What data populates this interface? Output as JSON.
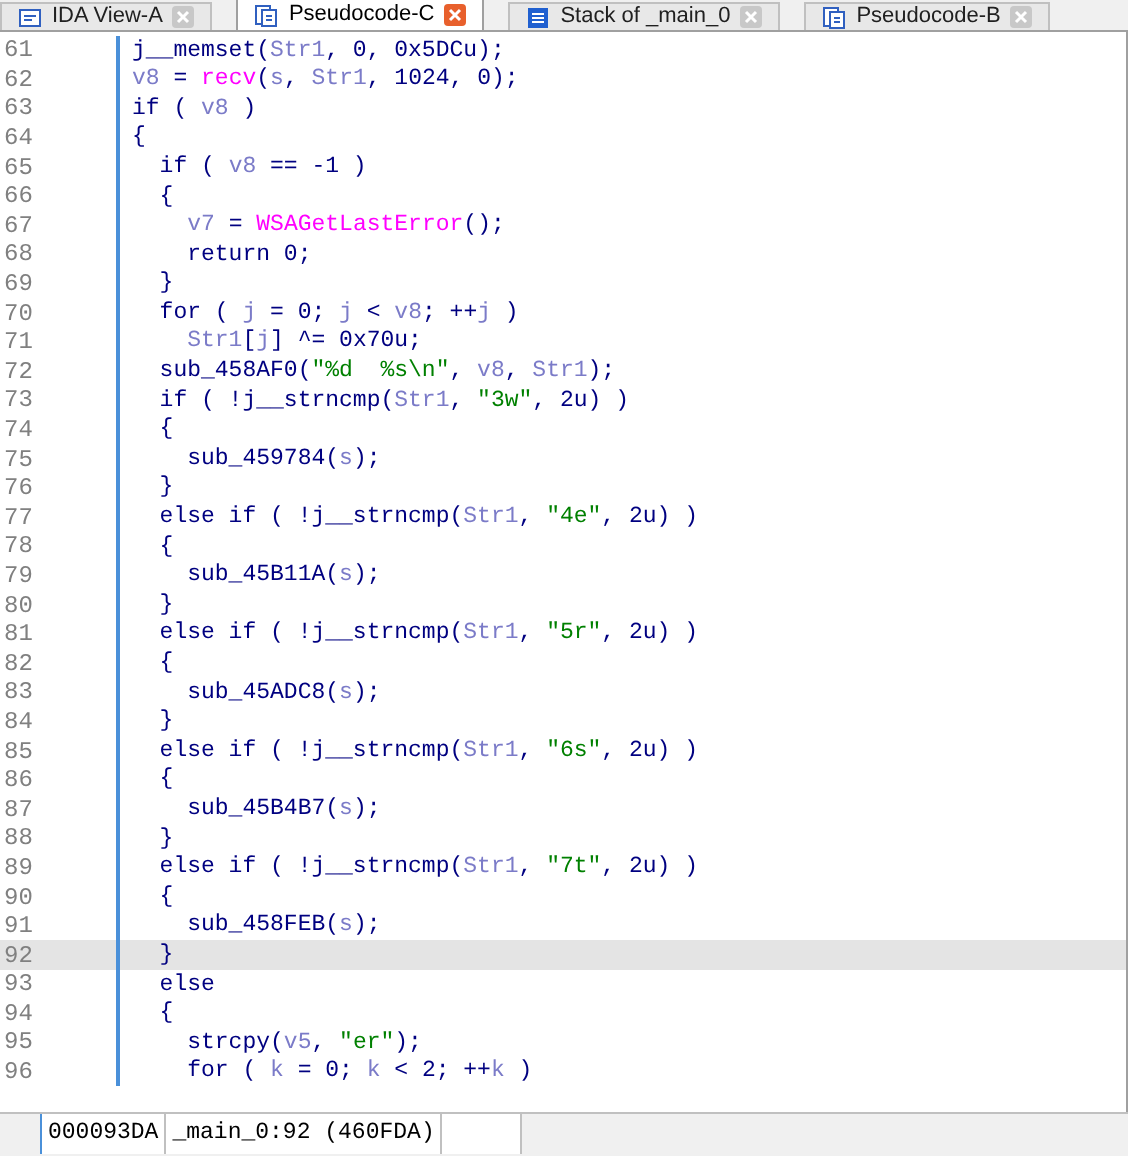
{
  "tabs": [
    {
      "label": "IDA View-A",
      "kind": "disassembly",
      "selected": false
    },
    {
      "label": "Pseudocode-C",
      "kind": "pseudocode",
      "selected": true
    },
    {
      "label": "Stack of _main_0",
      "kind": "stack",
      "selected": false
    },
    {
      "label": "Pseudocode-B",
      "kind": "pseudocode",
      "selected": false
    }
  ],
  "lines": [
    {
      "number": "61",
      "selected": false,
      "parts": [
        {
          "kind": "code",
          "text": "j__memset("
        },
        {
          "kind": "variable",
          "text": "Str1"
        },
        {
          "kind": "code",
          "text": ", 0, 0x5DCu);"
        }
      ]
    },
    {
      "number": "62",
      "selected": false,
      "parts": [
        {
          "kind": "variable",
          "text": "v8"
        },
        {
          "kind": "code",
          "text": " = "
        },
        {
          "kind": "function",
          "text": "recv"
        },
        {
          "kind": "code",
          "text": "("
        },
        {
          "kind": "variable",
          "text": "s"
        },
        {
          "kind": "code",
          "text": ", "
        },
        {
          "kind": "variable",
          "text": "Str1"
        },
        {
          "kind": "code",
          "text": ", 1024, 0);"
        }
      ]
    },
    {
      "number": "63",
      "selected": false,
      "parts": [
        {
          "kind": "code",
          "text": "if ( "
        },
        {
          "kind": "variable",
          "text": "v8"
        },
        {
          "kind": "code",
          "text": " )"
        }
      ]
    },
    {
      "number": "64",
      "selected": false,
      "parts": [
        {
          "kind": "code",
          "text": "{"
        }
      ]
    },
    {
      "number": "65",
      "selected": false,
      "parts": [
        {
          "kind": "code",
          "text": "  if ( "
        },
        {
          "kind": "variable",
          "text": "v8"
        },
        {
          "kind": "code",
          "text": " == -1 )"
        }
      ]
    },
    {
      "number": "66",
      "selected": false,
      "parts": [
        {
          "kind": "code",
          "text": "  {"
        }
      ]
    },
    {
      "number": "67",
      "selected": false,
      "parts": [
        {
          "kind": "variable",
          "text": "    v7"
        },
        {
          "kind": "code",
          "text": " = "
        },
        {
          "kind": "function",
          "text": "WSAGetLastError"
        },
        {
          "kind": "code",
          "text": "();"
        }
      ]
    },
    {
      "number": "68",
      "selected": false,
      "parts": [
        {
          "kind": "code",
          "text": "    return 0;"
        }
      ]
    },
    {
      "number": "69",
      "selected": false,
      "parts": [
        {
          "kind": "code",
          "text": "  }"
        }
      ]
    },
    {
      "number": "70",
      "selected": false,
      "parts": [
        {
          "kind": "code",
          "text": "  for ( "
        },
        {
          "kind": "variable",
          "text": "j"
        },
        {
          "kind": "code",
          "text": " = 0; "
        },
        {
          "kind": "variable",
          "text": "j"
        },
        {
          "kind": "code",
          "text": " < "
        },
        {
          "kind": "variable",
          "text": "v8"
        },
        {
          "kind": "code",
          "text": "; ++"
        },
        {
          "kind": "variable",
          "text": "j"
        },
        {
          "kind": "code",
          "text": " )"
        }
      ]
    },
    {
      "number": "71",
      "selected": false,
      "parts": [
        {
          "kind": "variable",
          "text": "    Str1"
        },
        {
          "kind": "code",
          "text": "["
        },
        {
          "kind": "variable",
          "text": "j"
        },
        {
          "kind": "code",
          "text": "] ^= 0x70u;"
        }
      ]
    },
    {
      "number": "72",
      "selected": false,
      "parts": [
        {
          "kind": "code",
          "text": "  sub_458AF0("
        },
        {
          "kind": "string",
          "text": "\"%d  %s\\n\""
        },
        {
          "kind": "code",
          "text": ", "
        },
        {
          "kind": "variable",
          "text": "v8"
        },
        {
          "kind": "code",
          "text": ", "
        },
        {
          "kind": "variable",
          "text": "Str1"
        },
        {
          "kind": "code",
          "text": ");"
        }
      ]
    },
    {
      "number": "73",
      "selected": false,
      "parts": [
        {
          "kind": "code",
          "text": "  if ( !j__strncmp("
        },
        {
          "kind": "variable",
          "text": "Str1"
        },
        {
          "kind": "code",
          "text": ", "
        },
        {
          "kind": "string",
          "text": "\"3w\""
        },
        {
          "kind": "code",
          "text": ", 2u) )"
        }
      ]
    },
    {
      "number": "74",
      "selected": false,
      "parts": [
        {
          "kind": "code",
          "text": "  {"
        }
      ]
    },
    {
      "number": "75",
      "selected": false,
      "parts": [
        {
          "kind": "code",
          "text": "    sub_459784("
        },
        {
          "kind": "variable",
          "text": "s"
        },
        {
          "kind": "code",
          "text": ");"
        }
      ]
    },
    {
      "number": "76",
      "selected": false,
      "parts": [
        {
          "kind": "code",
          "text": "  }"
        }
      ]
    },
    {
      "number": "77",
      "selected": false,
      "parts": [
        {
          "kind": "code",
          "text": "  else if ( !j__strncmp("
        },
        {
          "kind": "variable",
          "text": "Str1"
        },
        {
          "kind": "code",
          "text": ", "
        },
        {
          "kind": "string",
          "text": "\"4e\""
        },
        {
          "kind": "code",
          "text": ", 2u) )"
        }
      ]
    },
    {
      "number": "78",
      "selected": false,
      "parts": [
        {
          "kind": "code",
          "text": "  {"
        }
      ]
    },
    {
      "number": "79",
      "selected": false,
      "parts": [
        {
          "kind": "code",
          "text": "    sub_45B11A("
        },
        {
          "kind": "variable",
          "text": "s"
        },
        {
          "kind": "code",
          "text": ");"
        }
      ]
    },
    {
      "number": "80",
      "selected": false,
      "parts": [
        {
          "kind": "code",
          "text": "  }"
        }
      ]
    },
    {
      "number": "81",
      "selected": false,
      "parts": [
        {
          "kind": "code",
          "text": "  else if ( !j__strncmp("
        },
        {
          "kind": "variable",
          "text": "Str1"
        },
        {
          "kind": "code",
          "text": ", "
        },
        {
          "kind": "string",
          "text": "\"5r\""
        },
        {
          "kind": "code",
          "text": ", 2u) )"
        }
      ]
    },
    {
      "number": "82",
      "selected": false,
      "parts": [
        {
          "kind": "code",
          "text": "  {"
        }
      ]
    },
    {
      "number": "83",
      "selected": false,
      "parts": [
        {
          "kind": "code",
          "text": "    sub_45ADC8("
        },
        {
          "kind": "variable",
          "text": "s"
        },
        {
          "kind": "code",
          "text": ");"
        }
      ]
    },
    {
      "number": "84",
      "selected": false,
      "parts": [
        {
          "kind": "code",
          "text": "  }"
        }
      ]
    },
    {
      "number": "85",
      "selected": false,
      "parts": [
        {
          "kind": "code",
          "text": "  else if ( !j__strncmp("
        },
        {
          "kind": "variable",
          "text": "Str1"
        },
        {
          "kind": "code",
          "text": ", "
        },
        {
          "kind": "string",
          "text": "\"6s\""
        },
        {
          "kind": "code",
          "text": ", 2u) )"
        }
      ]
    },
    {
      "number": "86",
      "selected": false,
      "parts": [
        {
          "kind": "code",
          "text": "  {"
        }
      ]
    },
    {
      "number": "87",
      "selected": false,
      "parts": [
        {
          "kind": "code",
          "text": "    sub_45B4B7("
        },
        {
          "kind": "variable",
          "text": "s"
        },
        {
          "kind": "code",
          "text": ");"
        }
      ]
    },
    {
      "number": "88",
      "selected": false,
      "parts": [
        {
          "kind": "code",
          "text": "  }"
        }
      ]
    },
    {
      "number": "89",
      "selected": false,
      "parts": [
        {
          "kind": "code",
          "text": "  else if ( !j__strncmp("
        },
        {
          "kind": "variable",
          "text": "Str1"
        },
        {
          "kind": "code",
          "text": ", "
        },
        {
          "kind": "string",
          "text": "\"7t\""
        },
        {
          "kind": "code",
          "text": ", 2u) )"
        }
      ]
    },
    {
      "number": "90",
      "selected": false,
      "parts": [
        {
          "kind": "code",
          "text": "  {"
        }
      ]
    },
    {
      "number": "91",
      "selected": false,
      "parts": [
        {
          "kind": "code",
          "text": "    sub_458FEB("
        },
        {
          "kind": "variable",
          "text": "s"
        },
        {
          "kind": "code",
          "text": ");"
        }
      ]
    },
    {
      "number": "92",
      "selected": true,
      "parts": [
        {
          "kind": "code",
          "text": "  }"
        }
      ]
    },
    {
      "number": "93",
      "selected": false,
      "parts": [
        {
          "kind": "code",
          "text": "  else"
        }
      ]
    },
    {
      "number": "94",
      "selected": false,
      "parts": [
        {
          "kind": "code",
          "text": "  {"
        }
      ]
    },
    {
      "number": "95",
      "selected": false,
      "parts": [
        {
          "kind": "code",
          "text": "    strcpy("
        },
        {
          "kind": "variable",
          "text": "v5"
        },
        {
          "kind": "code",
          "text": ", "
        },
        {
          "kind": "string",
          "text": "\"er\""
        },
        {
          "kind": "code",
          "text": ");"
        }
      ]
    },
    {
      "number": "96",
      "selected": false,
      "parts": [
        {
          "kind": "code",
          "text": "    for ( "
        },
        {
          "kind": "variable",
          "text": "k"
        },
        {
          "kind": "code",
          "text": " = 0; "
        },
        {
          "kind": "variable",
          "text": "k"
        },
        {
          "kind": "code",
          "text": " < 2; ++"
        },
        {
          "kind": "variable",
          "text": "k"
        },
        {
          "kind": "code",
          "text": " )"
        }
      ]
    }
  ],
  "status_bar": {
    "address": "000093DA",
    "location": "_main_0:92 (460FDA)"
  }
}
